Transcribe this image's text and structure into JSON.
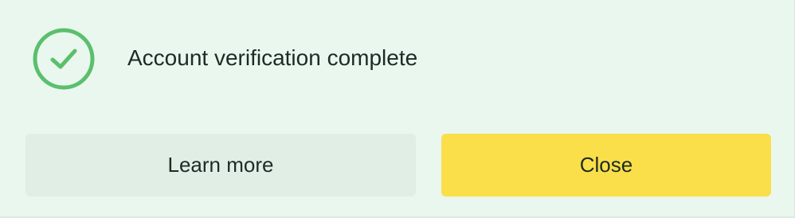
{
  "notification": {
    "icon": "check-circle-icon",
    "message": "Account verification complete",
    "colors": {
      "background": "#e9f7ef",
      "success": "#5bbf6c",
      "primary_button": "#fadf4b",
      "secondary_button": "#e0eee6",
      "text": "#1d2b24"
    }
  },
  "actions": {
    "secondary_label": "Learn more",
    "primary_label": "Close"
  }
}
